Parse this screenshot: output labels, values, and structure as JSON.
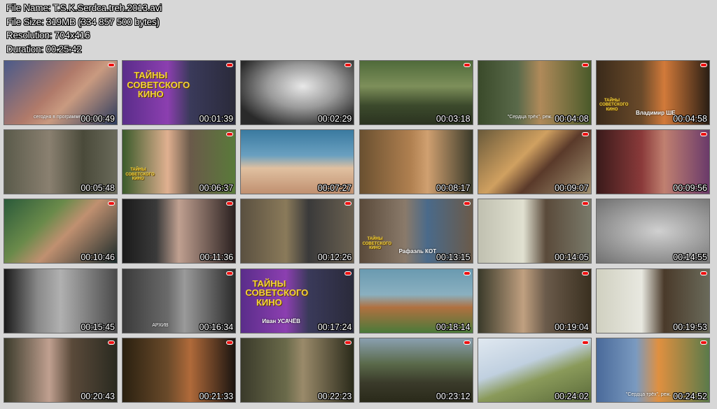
{
  "file_info": {
    "name_line": "File Name: T.S.K.Serdca.treh.2013.avi",
    "size_line": "File Size: 319MB (334 857 500 bytes)",
    "resolution_line": "Resolution: 704x416",
    "duration_line": "Duration: 00:25:42"
  },
  "thumbnails": [
    {
      "time": "00:00:49",
      "caption": "сегодня в программе",
      "bg": "linear-gradient(135deg,#4a5a8a,#b07a6a 45%,#c99a80 60%,#2c3b5e)",
      "logo": true
    },
    {
      "time": "00:01:39",
      "title": "ТАЙНЫ СОВЕТСКОГО КИНО",
      "bg": "linear-gradient(90deg,#5a2d8a,#8c3fb0 40%,#3a3a5a 60%,#2a2a3a)",
      "logo": true
    },
    {
      "time": "00:02:29",
      "bg": "radial-gradient(ellipse at 55% 40%,#e8e8e8 0%,#9a9a9a 40%,#2a2a2a 80%)",
      "logo": true
    },
    {
      "time": "00:03:18",
      "bg": "linear-gradient(180deg,#4f6a3a,#7d8f5a 40%,#3c4a2c 70%,#2b3320)",
      "logo": true
    },
    {
      "time": "00:04:08",
      "caption": "\"Сердца трёх\", реж.",
      "bg": "linear-gradient(90deg,#3a4a2a,#5a6a4a 35%,#b08a5a 55%,#4a5a2a)",
      "logo": true
    },
    {
      "time": "00:04:58",
      "name": "Владимир ШЕ",
      "title": "ТАЙНЫ СОВЕТСКОГО КИНО",
      "small_title": true,
      "bg": "linear-gradient(90deg,#3a2a1a,#6a4a2a 40%,#d27a3a 60%,#2a1e14)",
      "logo": true
    },
    {
      "time": "00:05:48",
      "bg": "linear-gradient(90deg,#5a5a4a,#8a8070 40%,#4a4a3a 70%,#6a6a5a)",
      "logo": false
    },
    {
      "time": "00:06:37",
      "name": "",
      "title": "ТАЙНЫ СОВЕТСКОГО КИНО",
      "small_title": true,
      "bg": "linear-gradient(90deg,#3a5a2a,#e0b090 40%,#6a5a4a 60%,#5a7a3a)",
      "logo": true
    },
    {
      "time": "00:07:27",
      "bg": "linear-gradient(180deg,#3a7aa0,#6aa0c0 40%,#e0c0a0 60%,#c09070)",
      "logo": false
    },
    {
      "time": "00:08:17",
      "bg": "linear-gradient(90deg,#6a5030,#b08050 45%,#d0a070 60%,#3a3a2a)",
      "logo": false
    },
    {
      "time": "00:09:07",
      "bg": "linear-gradient(135deg,#6a5a3a,#d0a060 40%,#5a3a2a 60%,#a09070)",
      "logo": true
    },
    {
      "time": "00:09:56",
      "bg": "linear-gradient(90deg,#3a1a1a,#8a3a3a 40%,#c08070 60%,#6a3a6a)",
      "logo": true
    },
    {
      "time": "00:10:46",
      "bg": "linear-gradient(135deg,#2a5a3a,#6a8a4a 35%,#c09070 55%,#1a2a2a)",
      "logo": true
    },
    {
      "time": "00:11:36",
      "bg": "linear-gradient(90deg,#1a1a1a,#3a3a3a 30%,#c0a090 50%,#2a2020)",
      "logo": true
    },
    {
      "time": "00:12:26",
      "bg": "linear-gradient(90deg,#5a5040,#8a7a5a 40%,#3a3a3a 60%,#6a6050)",
      "logo": true
    },
    {
      "time": "00:13:15",
      "name": "Рафаэль КОТ",
      "title": "ТАЙНЫ СОВЕТСКОГО КИНО",
      "small_title": true,
      "bg": "linear-gradient(90deg,#5a4a3a,#8a7a6a 40%,#4a6a8a 60%,#6a5a4a)",
      "logo": true
    },
    {
      "time": "00:14:05",
      "bg": "linear-gradient(90deg,#c0c0b0,#e0e0d0 40%,#5a4a3a 60%,#7a7a6a)",
      "logo": true
    },
    {
      "time": "00:14:55",
      "bg": "radial-gradient(ellipse at 55% 50%,#d0d0d0 0%,#a0a0a0 50%,#707070 100%)",
      "logo": false
    },
    {
      "time": "00:15:45",
      "bg": "linear-gradient(90deg,#1a1a1a,#8a8a8a 30%,#b0b0b0 50%,#4a4a4a)",
      "logo": false
    },
    {
      "time": "00:16:34",
      "caption": "АРХИВ",
      "bg": "linear-gradient(90deg,#3a3a3a,#6a6a6a 40%,#9a9a9a 55%,#2a2a2a)",
      "logo": true
    },
    {
      "time": "00:17:24",
      "name": "Иван УСАЧЁВ",
      "title": "ТАЙНЫ СОВЕТСКОГО КИНО",
      "bg": "linear-gradient(90deg,#5a2d8a,#8c3fb0 40%,#3a3a5a 60%,#2a2a3a)",
      "logo": true
    },
    {
      "time": "00:18:14",
      "bg": "linear-gradient(180deg,#6a9ab0,#8ab0c0 40%,#b07040 60%,#4a7a3a)",
      "logo": true
    },
    {
      "time": "00:19:04",
      "bg": "linear-gradient(90deg,#3a3a2a,#c0a080 40%,#6a5a4a 60%,#3a3020)",
      "logo": true
    },
    {
      "time": "00:19:53",
      "bg": "linear-gradient(90deg,#d0d0c0,#e8e8e0 40%,#4a3a2a 60%,#6a6a5a)",
      "logo": true
    },
    {
      "time": "00:20:43",
      "bg": "linear-gradient(90deg,#3a3a2a,#c0a090 40%,#5a4a3a 60%,#2a2a20)",
      "logo": true
    },
    {
      "time": "00:21:33",
      "bg": "linear-gradient(90deg,#2a2010,#6a4a2a 40%,#b06a3a 60%,#1a1410)",
      "logo": true
    },
    {
      "time": "00:22:23",
      "bg": "linear-gradient(90deg,#3a3a2a,#6a6a4a 40%,#9a8a6a 55%,#2a2a1a)",
      "logo": true
    },
    {
      "time": "00:23:12",
      "bg": "linear-gradient(180deg,#8aa0b0,#5a6a4a 40%,#3a3a2a 70%,#2a2a1a)",
      "logo": true
    },
    {
      "time": "00:24:02",
      "bg": "linear-gradient(160deg,#e0e8f0,#c0d0e0 40%,#8a9a5a 60%,#5a6a3a)",
      "logo": true
    },
    {
      "time": "00:24:52",
      "caption": "\"Сердца трёх\", реж.",
      "bg": "linear-gradient(90deg,#4a6a9a,#7a9ac0 35%,#e09040 55%,#5a7a4a)",
      "logo": true
    }
  ]
}
